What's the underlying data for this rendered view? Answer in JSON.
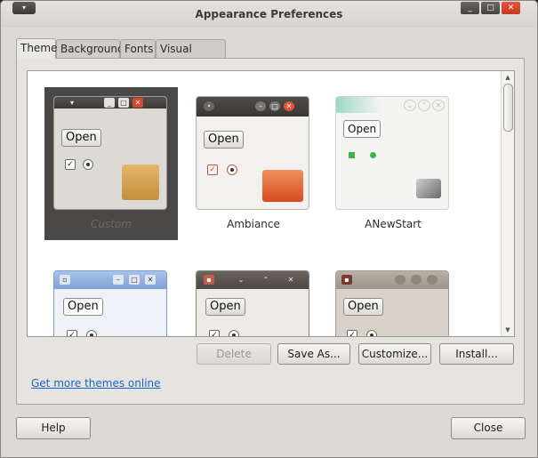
{
  "window": {
    "title": "Appearance Preferences",
    "controls": {
      "menu": "▾",
      "minimize": "_",
      "maximize": "□",
      "close": "✕"
    }
  },
  "tabs": [
    {
      "label": "Theme",
      "active": true
    },
    {
      "label": "Background",
      "active": false
    },
    {
      "label": "Fonts",
      "active": false
    },
    {
      "label": "Visual Effects",
      "active": false
    }
  ],
  "themes": [
    {
      "label": "Custom",
      "selected": true,
      "preview_button": "Open"
    },
    {
      "label": "Ambiance",
      "selected": false,
      "preview_button": "Open"
    },
    {
      "label": "ANewStart",
      "selected": false,
      "preview_button": "Open"
    },
    {
      "label": "",
      "selected": false,
      "preview_button": "Open"
    },
    {
      "label": "",
      "selected": false,
      "preview_button": "Open"
    },
    {
      "label": "",
      "selected": false,
      "preview_button": "Open"
    }
  ],
  "scrollbar": {
    "up": "▲",
    "down": "▼"
  },
  "actions": {
    "delete": "Delete",
    "save_as": "Save As...",
    "customize": "Customize...",
    "install": "Install..."
  },
  "link": {
    "text": "Get more themes online"
  },
  "footer": {
    "help": "Help",
    "close": "Close"
  },
  "colors": {
    "accent_link": "#1a64c8",
    "close_button": "#d9472b",
    "selection": "#4a4846"
  }
}
